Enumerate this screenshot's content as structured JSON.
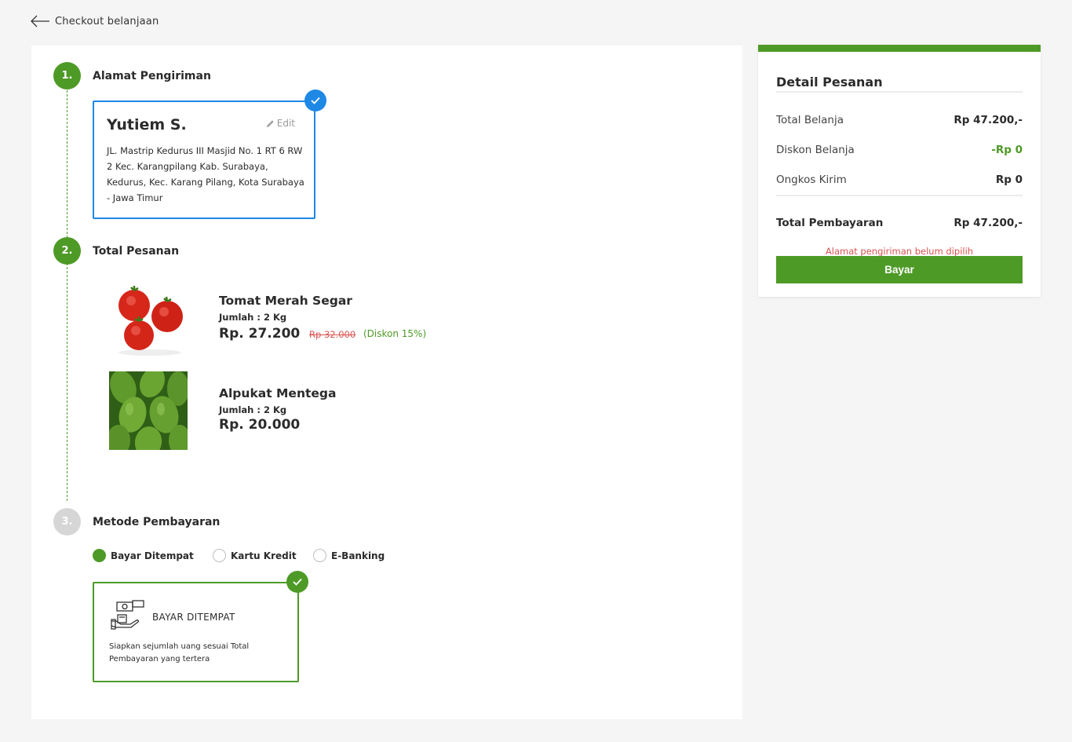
{
  "header": {
    "back_label": "Checkout belanjaan"
  },
  "steps": {
    "address": {
      "number": "1.",
      "title": "Alamat Pengiriman"
    },
    "order": {
      "number": "2.",
      "title": "Total Pesanan"
    },
    "payment": {
      "number": "3.",
      "title": "Metode Pembayaran"
    }
  },
  "address": {
    "name": "Yutiem S.",
    "edit_label": "Edit",
    "text": "JL. Mastrip Kedurus III Masjid No. 1 RT 6 RW 2 Kec. Karangpilang Kab. Surabaya, Kedurus, Kec. Karang Pilang, Kota Surabaya - Jawa Timur"
  },
  "products": [
    {
      "name": "Tomat Merah Segar",
      "qty": "Jumlah : 2 Kg",
      "price": "Rp. 27.200",
      "original_price": "Rp 32.000",
      "discount": "(Diskon 15%)"
    },
    {
      "name": "Alpukat Mentega",
      "qty": "Jumlah : 2 Kg",
      "price": "Rp. 20.000"
    }
  ],
  "payment_options": [
    {
      "label": "Bayar Ditempat",
      "selected": true
    },
    {
      "label": "Kartu Kredit",
      "selected": false
    },
    {
      "label": "E-Banking",
      "selected": false
    }
  ],
  "payment_detail": {
    "title": "BAYAR DITEMPAT",
    "description": "Siapkan sejumlah uang sesuai Total Pembayaran yang tertera"
  },
  "summary": {
    "title": "Detail Pesanan",
    "rows": [
      {
        "label": "Total Belanja",
        "value": "Rp 47.200,-"
      },
      {
        "label": "Diskon Belanja",
        "value": "-Rp 0"
      },
      {
        "label": "Ongkos Kirim",
        "value": "Rp 0"
      }
    ],
    "total_label": "Total Pembayaran",
    "total_value": "Rp 47.200,-",
    "warning": "Alamat pengiriman belum dipilih",
    "pay_button": "Bayar"
  },
  "colors": {
    "accent": "#4e9a27",
    "selected_blue": "#1e88e5",
    "warning": "#d9534f"
  }
}
